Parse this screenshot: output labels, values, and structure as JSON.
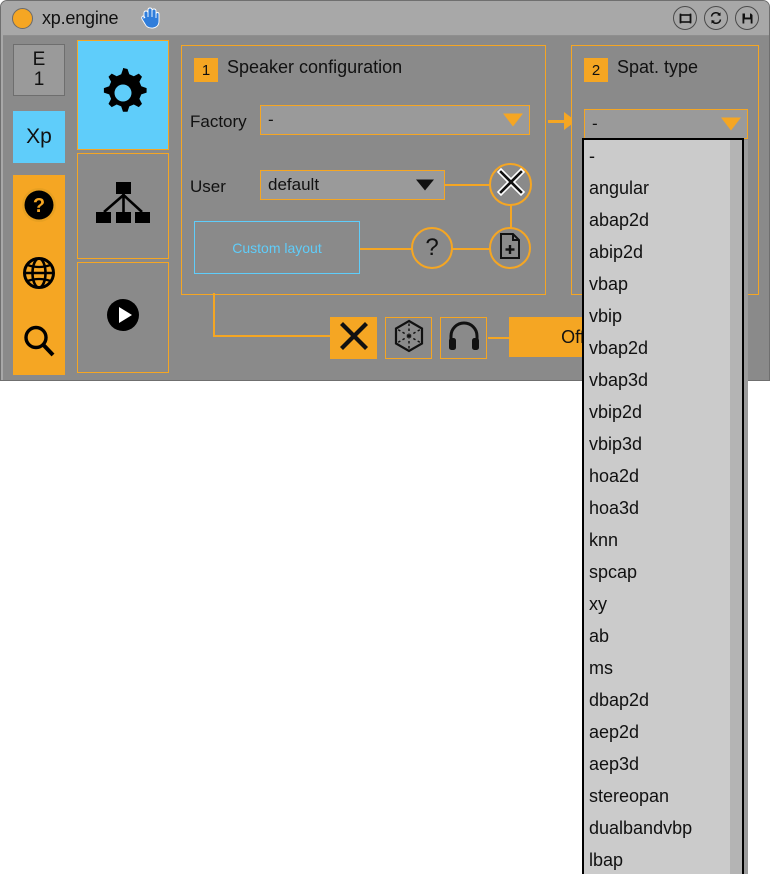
{
  "window": {
    "title": "xp.engine",
    "dot_color": "#f5a623",
    "titlebar_buttons": [
      {
        "name": "window-frame-icon",
        "label": "window"
      },
      {
        "name": "refresh-icon",
        "label": "refresh"
      },
      {
        "name": "save-icon",
        "label": "save"
      }
    ],
    "hand_cursor_icon": "hand-icon"
  },
  "sidebar": {
    "preset_button": {
      "line1": "E",
      "line2": "1"
    },
    "xp_button": {
      "label": "Xp"
    },
    "tool_icons": [
      {
        "name": "help-icon",
        "label": "help"
      },
      {
        "name": "globe-icon",
        "label": "globe"
      },
      {
        "name": "search-icon",
        "label": "search"
      }
    ]
  },
  "modes": [
    {
      "name": "mode-settings",
      "icon": "gear-icon",
      "active": true
    },
    {
      "name": "mode-routing",
      "icon": "hierarchy-icon",
      "active": false
    },
    {
      "name": "mode-playback",
      "icon": "play-icon",
      "active": false
    }
  ],
  "section1": {
    "number": "1",
    "title": "Speaker configuration",
    "factory": {
      "label": "Factory",
      "value": "-"
    },
    "user": {
      "label": "User",
      "value": "default"
    },
    "custom_layout": {
      "label": "Custom layout"
    },
    "buttons": [
      {
        "name": "clear-button",
        "icon": "x-icon"
      },
      {
        "name": "help-button",
        "icon": "question-icon"
      },
      {
        "name": "new-file-button",
        "icon": "file-plus-icon"
      }
    ]
  },
  "section2": {
    "number": "2",
    "title": "Spat. type",
    "selected": "-"
  },
  "toolbar": {
    "buttons": [
      {
        "name": "mute-button",
        "icon": "x-icon",
        "active": true
      },
      {
        "name": "cube-button",
        "icon": "cube-icon",
        "active": false
      },
      {
        "name": "headphones-button",
        "icon": "headphones-icon",
        "active": false
      }
    ],
    "status_label": "Off"
  },
  "dropdown_menu": {
    "open": true,
    "items": [
      "-",
      "angular",
      "abap2d",
      "abip2d",
      "vbap",
      "vbip",
      "vbap2d",
      "vbap3d",
      "vbip2d",
      "vbip3d",
      "hoa2d",
      "hoa3d",
      "knn",
      "spcap",
      "xy",
      "ab",
      "ms",
      "dbap2d",
      "aep2d",
      "aep3d",
      "stereopan",
      "dualbandvbp",
      "lbap"
    ]
  },
  "colors": {
    "accent_orange": "#f5a623",
    "accent_cyan": "#5fcdfa",
    "window_bg": "#a8a8a8",
    "body_bg": "#8a8a8a",
    "menu_bg": "#cbcbcb"
  }
}
